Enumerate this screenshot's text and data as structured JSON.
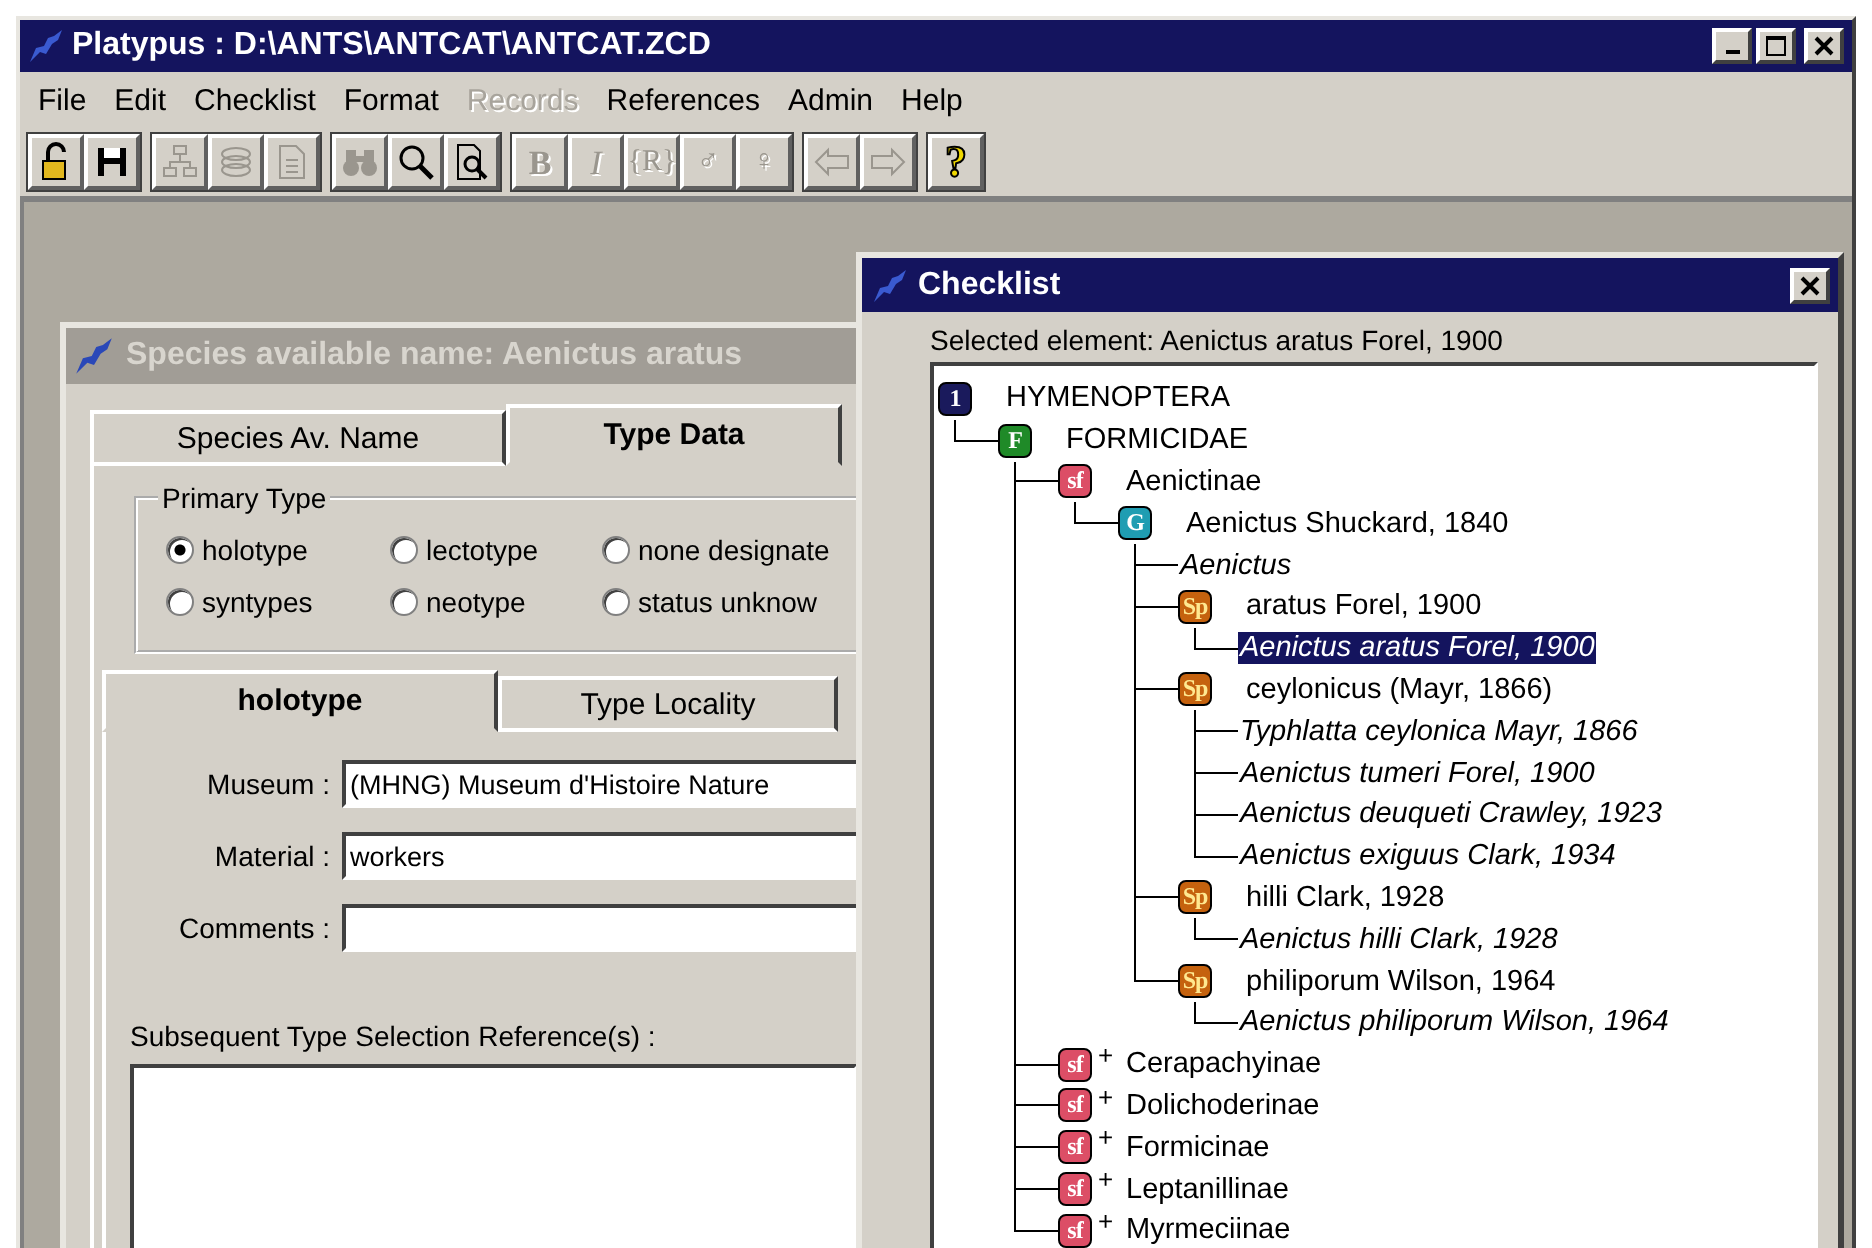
{
  "window": {
    "title": "Platypus : D:\\ANTS\\ANTCAT\\ANTCAT.ZCD"
  },
  "menu": [
    {
      "label": "File",
      "disabled": false
    },
    {
      "label": "Edit",
      "disabled": false
    },
    {
      "label": "Checklist",
      "disabled": false
    },
    {
      "label": "Format",
      "disabled": false
    },
    {
      "label": "Records",
      "disabled": true
    },
    {
      "label": "References",
      "disabled": false
    },
    {
      "label": "Admin",
      "disabled": false
    },
    {
      "label": "Help",
      "disabled": false
    }
  ],
  "toolbar": [
    [
      {
        "kind": "lock",
        "disabled": false
      },
      {
        "kind": "save",
        "disabled": false
      }
    ],
    [
      {
        "kind": "hierarchy",
        "disabled": true
      },
      {
        "kind": "layers",
        "disabled": true
      },
      {
        "kind": "document",
        "disabled": true
      }
    ],
    [
      {
        "kind": "binoculars",
        "disabled": true
      },
      {
        "kind": "search",
        "disabled": false
      },
      {
        "kind": "preview",
        "disabled": false
      }
    ],
    [
      {
        "kind": "bold",
        "label": "B",
        "disabled": true
      },
      {
        "kind": "italic",
        "label": "I",
        "disabled": true
      },
      {
        "kind": "text",
        "label": "{R}",
        "disabled": true
      },
      {
        "kind": "text",
        "label": "♂",
        "disabled": true
      },
      {
        "kind": "text",
        "label": "♀",
        "disabled": true
      }
    ],
    [
      {
        "kind": "back",
        "disabled": true
      },
      {
        "kind": "forward",
        "disabled": true
      }
    ],
    [
      {
        "kind": "help",
        "label": "?",
        "disabled": false
      }
    ]
  ],
  "species_window": {
    "title": "Species available name:  Aenictus aratus",
    "tabs": [
      {
        "label": "Species Av. Name",
        "selected": false
      },
      {
        "label": "Type Data",
        "selected": true
      }
    ],
    "primary_type": {
      "legend": "Primary Type",
      "options": [
        {
          "label": "holotype",
          "checked": true
        },
        {
          "label": "lectotype",
          "checked": false
        },
        {
          "label": "none designate",
          "checked": false
        },
        {
          "label": "syntypes",
          "checked": false
        },
        {
          "label": "neotype",
          "checked": false
        },
        {
          "label": "status unknow",
          "checked": false
        }
      ]
    },
    "sub_tabs": [
      {
        "label": "holotype",
        "selected": true
      },
      {
        "label": "Type Locality",
        "selected": false
      }
    ],
    "fields": [
      {
        "label": "Museum :",
        "value": "(MHNG) Museum d'Histoire Nature"
      },
      {
        "label": "Material :",
        "value": "workers"
      },
      {
        "label": "Comments :"
      }
    ],
    "references_label": "Subsequent Type Selection Reference(s) :"
  },
  "checklist": {
    "title": "Checklist",
    "selected_element": "Selected element:  Aenictus aratus Forel, 1900",
    "tree": [
      {
        "kind": "order",
        "badge": "1",
        "label": "HYMENOPTERA",
        "selected": false,
        "children": [
          {
            "kind": "family",
            "badge": "F",
            "label": "FORMICIDAE",
            "selected": false,
            "children": [
              {
                "kind": "subfamily",
                "badge": "sf",
                "label": "Aenictinae",
                "selected": false,
                "children": [
                  {
                    "kind": "genus",
                    "badge": "G",
                    "label": "Aenictus Shuckard, 1840",
                    "selected": false,
                    "children": [
                      {
                        "kind": "synonym",
                        "label": "Aenictus",
                        "selected": false
                      },
                      {
                        "kind": "species",
                        "badge": "Sp",
                        "label": "aratus Forel, 1900",
                        "selected": false,
                        "children": [
                          {
                            "kind": "synonym",
                            "label": "Aenictus aratus Forel, 1900",
                            "selected": true
                          }
                        ]
                      },
                      {
                        "kind": "species",
                        "badge": "Sp",
                        "label": "ceylonicus (Mayr, 1866)",
                        "selected": false,
                        "children": [
                          {
                            "kind": "synonym",
                            "label": "Typhlatta ceylonica Mayr, 1866",
                            "selected": false
                          },
                          {
                            "kind": "synonym",
                            "label": "Aenictus tumeri Forel, 1900",
                            "selected": false
                          },
                          {
                            "kind": "synonym",
                            "label": "Aenictus deuqueti Crawley, 1923",
                            "selected": false
                          },
                          {
                            "kind": "synonym",
                            "label": "Aenictus exiguus Clark, 1934",
                            "selected": false
                          }
                        ]
                      },
                      {
                        "kind": "species",
                        "badge": "Sp",
                        "label": "hilli Clark, 1928",
                        "selected": false,
                        "children": [
                          {
                            "kind": "synonym",
                            "label": "Aenictus hilli Clark, 1928",
                            "selected": false
                          }
                        ]
                      },
                      {
                        "kind": "species",
                        "badge": "Sp",
                        "label": "philiporum Wilson, 1964",
                        "selected": false,
                        "children": [
                          {
                            "kind": "synonym",
                            "label": "Aenictus philiporum Wilson, 1964",
                            "selected": false
                          }
                        ]
                      }
                    ]
                  }
                ]
              },
              {
                "kind": "subfamily",
                "badge": "sf",
                "expander": "+",
                "label": "Cerapachyinae",
                "selected": false
              },
              {
                "kind": "subfamily",
                "badge": "sf",
                "expander": "+",
                "label": "Dolichoderinae",
                "selected": false
              },
              {
                "kind": "subfamily",
                "badge": "sf",
                "expander": "+",
                "label": "Formicinae",
                "selected": false
              },
              {
                "kind": "subfamily",
                "badge": "sf",
                "expander": "+",
                "label": "Leptanillinae",
                "selected": false
              },
              {
                "kind": "subfamily",
                "badge": "sf",
                "expander": "+",
                "label": "Myrmeciinae",
                "selected": false
              }
            ]
          }
        ]
      }
    ]
  }
}
